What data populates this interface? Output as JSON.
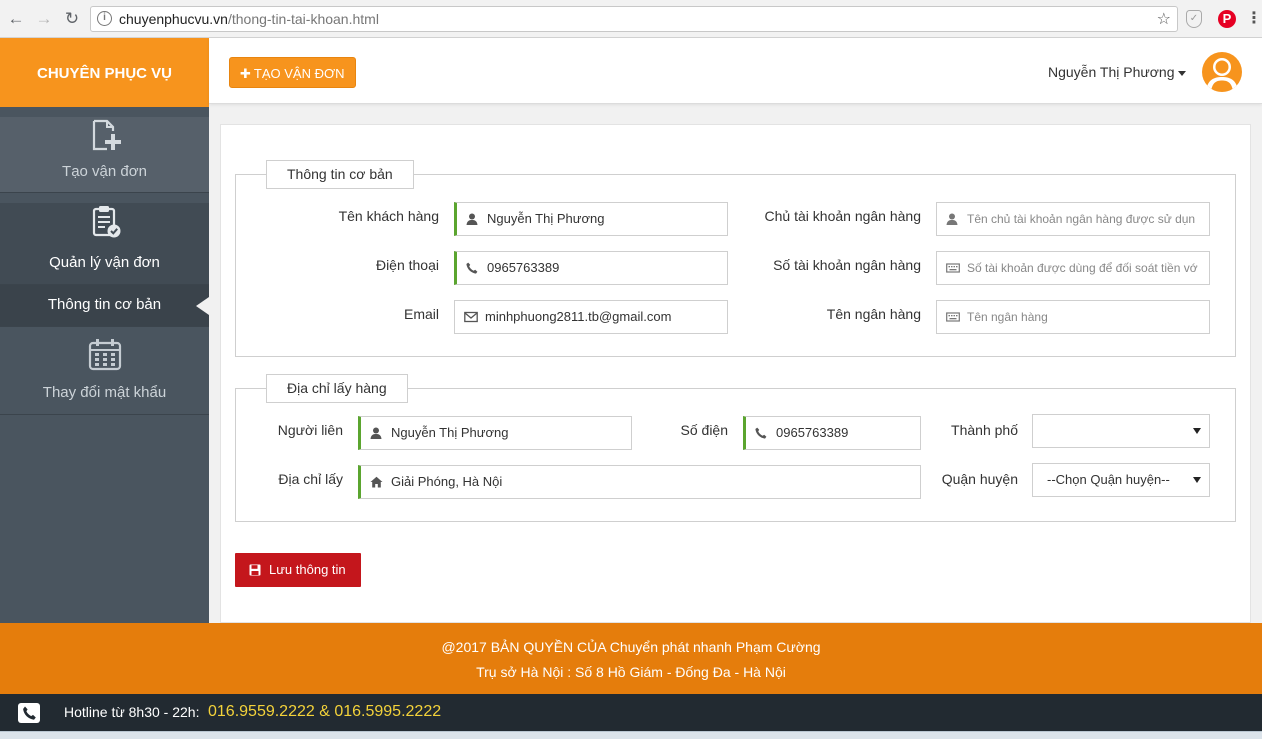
{
  "browser": {
    "url_domain": "chuyenphucvu.vn",
    "url_path": "/thong-tin-tai-khoan.html"
  },
  "brand": "CHUYÊN PHỤC VỤ",
  "sidebar": {
    "items": [
      {
        "label": "Tạo vận đơn",
        "icon": "file-plus-icon"
      },
      {
        "label": "Quản lý vận đơn",
        "icon": "clipboard-check-icon"
      },
      {
        "label": "Thông tin cơ bản",
        "icon": ""
      },
      {
        "label": "Thay đổi mật khẩu",
        "icon": "calendar-icon"
      }
    ]
  },
  "header": {
    "create_label": "TẠO VẬN ĐƠN",
    "user_name": "Nguyễn Thị Phương"
  },
  "basic_info": {
    "legend": "Thông tin cơ bản",
    "customer_name_label": "Tên khách hàng",
    "customer_name_value": "Nguyễn Thị Phương",
    "phone_label": "Điện thoại",
    "phone_value": "0965763389",
    "email_label": "Email",
    "email_value": "minhphuong2811.tb@gmail.com",
    "bank_owner_label": "Chủ tài khoản ngân hàng",
    "bank_owner_placeholder": "Tên chủ tài khoản ngân hàng được sử dụn",
    "bank_number_label": "Số tài khoản ngân hàng",
    "bank_number_placeholder": "Số tài khoản được dùng để đối soát tiền vớ",
    "bank_name_label": "Tên ngân hàng",
    "bank_name_placeholder": "Tên ngân hàng"
  },
  "pickup": {
    "legend": "Địa chỉ lấy hàng",
    "contact_label": "Người liên",
    "contact_value": "Nguyễn Thị Phương",
    "phone_label": "Số điện",
    "phone_value": "0965763389",
    "city_label": "Thành phố",
    "city_value": "",
    "address_label": "Địa chỉ lấy",
    "address_value": "Giải Phóng, Hà Nội",
    "district_label": "Quận huyện",
    "district_value": "--Chọn Quận huyện--"
  },
  "save_label": "Lưu thông tin",
  "footer": {
    "line1": "@2017 BẢN QUYỀN CỦA Chuyển phát nhanh Phạm Cường",
    "line2": "Trụ sở Hà Nội : Số 8 Hồ Giám - Đống Đa - Hà Nội"
  },
  "hotline": {
    "label": "Hotline từ 8h30 - 22h:",
    "numbers": "016.9559.2222 & 016.5995.2222"
  },
  "colors": {
    "brand_orange": "#f7941d",
    "footer_orange": "#e57d0c",
    "sidebar": "#4a555f",
    "save_red": "#c4161c",
    "input_accent_green": "#5ba52f",
    "hotline_yellow": "#f3d23a"
  }
}
